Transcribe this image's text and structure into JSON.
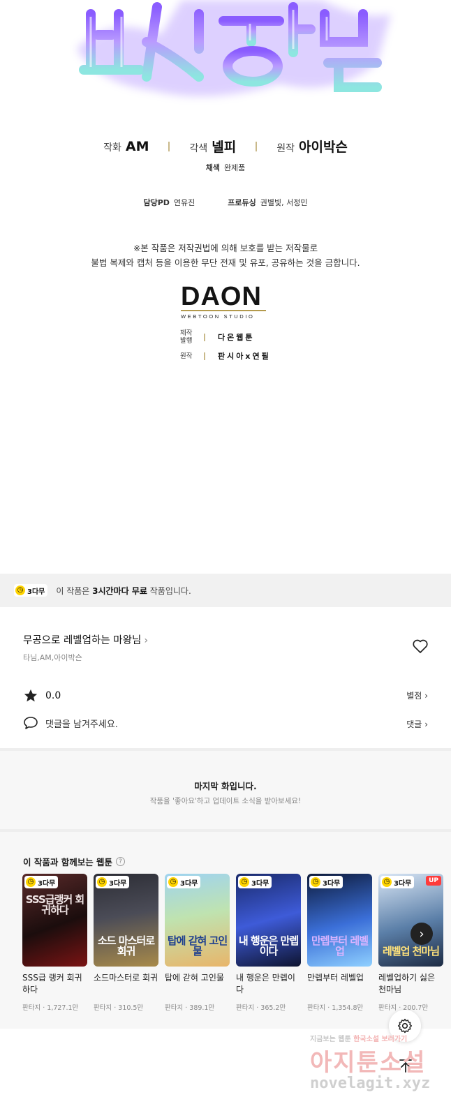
{
  "credits": {
    "roles": [
      {
        "label": "작화",
        "name": "AM"
      },
      {
        "label": "각색",
        "name": "넬피"
      },
      {
        "label": "원작",
        "name": "아이박슨"
      }
    ],
    "color": {
      "label": "채색",
      "name": "완제품"
    },
    "pd": {
      "label": "담당PD",
      "name": "연유진"
    },
    "producing": {
      "label": "프로듀싱",
      "name": "권별빛, 서정민"
    },
    "notice_line1": "※본 작품은 저작권법에 의해 보호를 받는 저작물로",
    "notice_line2": "불법 복제와 캡처 등을 이용한 무단 전재 및 유포, 공유하는 것을 금합니다.",
    "studio": {
      "name": "DAON",
      "sub": "WEBTOON STUDIO"
    },
    "production": {
      "label1": "제작",
      "label2": "발행",
      "name": "다온웹툰"
    },
    "original": {
      "label": "원작",
      "name": "판시아x연필"
    }
  },
  "free_bar": {
    "badge": "3다무",
    "text_prefix": "이 작품은 ",
    "text_bold": "3시간마다 무료",
    "text_suffix": " 작품입니다."
  },
  "series": {
    "title": "무공으로 레벨업하는 마왕님",
    "authors": "타님,AM,아이박슨",
    "rating": "0.0",
    "rating_link": "별점",
    "comment_placeholder": "댓글을 남겨주세요.",
    "comment_link": "댓글"
  },
  "last_episode": {
    "title": "마지막 화입니다.",
    "subtitle": "작품을 '좋아요'하고 업데이트 소식을 받아보세요!"
  },
  "recommendations": {
    "heading": "이 작품과 함께보는 웹툰",
    "items": [
      {
        "badge": "3다무",
        "title": "SSS급 랭커 회귀하다",
        "meta": "판타지 · 1,727.1만",
        "cover_text": "SSS급랭커 회귀하다",
        "up": ""
      },
      {
        "badge": "3다무",
        "title": "소드마스터로 회귀",
        "meta": "판타지 · 310.5만",
        "cover_text": "소드 마스터로 회귀",
        "up": ""
      },
      {
        "badge": "3다무",
        "title": "탑에 갇혀 고인물",
        "meta": "판타지 · 389.1만",
        "cover_text": "탑에 갇혀 고인물",
        "up": ""
      },
      {
        "badge": "3다무",
        "title": "내 행운은 만렙이다",
        "meta": "판타지 · 365.2만",
        "cover_text": "내 행운은 만렙이다",
        "up": ""
      },
      {
        "badge": "3다무",
        "title": "만렙부터 레벨업",
        "meta": "판타지 · 1,354.8만",
        "cover_text": "만렙부터 레벨업",
        "up": ""
      },
      {
        "badge": "3다무",
        "title": "레벨업하기 싫은 천마님",
        "meta": "판타지 · 200.7만",
        "cover_text": "레벨업 천마님",
        "up": "UP"
      }
    ]
  },
  "colors": {
    "accent_gold": "#c9b98a",
    "badge_yellow": "#ffd400",
    "up_red": "#ff3b3b"
  },
  "watermark": {
    "line1_gray": "지금보는 웹툰",
    "line1_red": "한국소설 보러가기",
    "brand": "아지툰소설",
    "url": "novelagit.xyz"
  },
  "icons": {
    "heart": "heart-icon",
    "star": "star-icon",
    "comment": "comment-icon",
    "settings": "gear-icon",
    "top": "arrow-up-icon",
    "next": "chevron-right-icon"
  }
}
